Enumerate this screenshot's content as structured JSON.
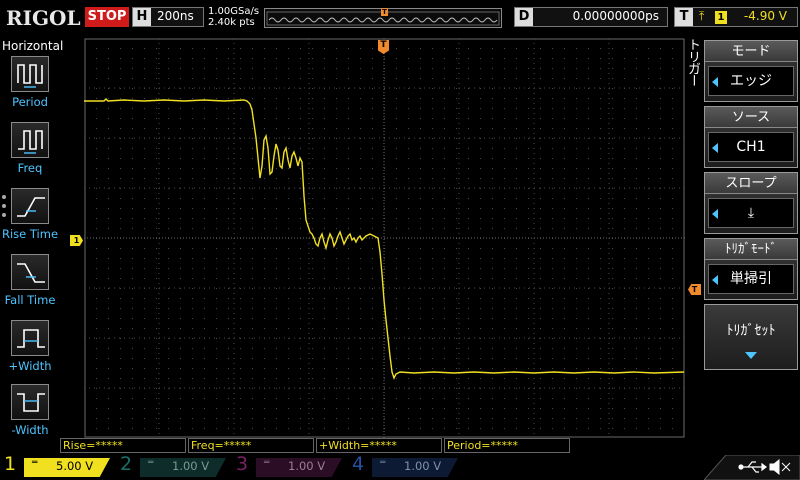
{
  "brand": {
    "logo": "RIGOL"
  },
  "status": {
    "run_state": "STOP"
  },
  "horizontal": {
    "label": "H",
    "timebase": "200ns"
  },
  "acquisition": {
    "sample_rate": "1.00GSa/s",
    "points": "2.40k pts"
  },
  "delay": {
    "label": "D",
    "value": "0.00000000ps"
  },
  "trigger_status": {
    "label": "T",
    "edge_symbol": "⤒",
    "channel": "1",
    "level": "-4.90 V"
  },
  "left_panel": {
    "title": "Horizontal",
    "items": [
      {
        "label": "Period",
        "icon": "period-icon"
      },
      {
        "label": "Freq",
        "icon": "freq-icon"
      },
      {
        "label": "Rise Time",
        "icon": "rise-time-icon"
      },
      {
        "label": "Fall Time",
        "icon": "fall-time-icon"
      },
      {
        "label": "+Width",
        "icon": "positive-width-icon"
      },
      {
        "label": "-Width",
        "icon": "negative-width-icon"
      }
    ]
  },
  "markers": {
    "channel_marker": "1",
    "trigger_marker": "T",
    "trigger_level_marker": "T"
  },
  "right_menu": {
    "title": "トリガー",
    "items": [
      {
        "header": "モード",
        "value": "エッジ"
      },
      {
        "header": "ソース",
        "value": "CH1"
      },
      {
        "header": "スロープ",
        "value": "⤓"
      },
      {
        "header": "ﾄﾘｶﾞﾓｰﾄﾞ",
        "value": "単掃引"
      }
    ],
    "bottom_button": "ﾄﾘｶﾞｾｯﾄ"
  },
  "measurements": [
    {
      "label": "Rise=*****"
    },
    {
      "label": "Freq=*****"
    },
    {
      "label": "+Width=*****"
    },
    {
      "label": "Period=*****"
    }
  ],
  "channels": [
    {
      "number": "1",
      "coupling": "═",
      "scale": "5.00 V",
      "color": "#f0e020",
      "active": true
    },
    {
      "number": "2",
      "coupling": "═",
      "scale": "1.00 V",
      "color": "#1fb9b0",
      "active": false
    },
    {
      "number": "3",
      "coupling": "═",
      "scale": "1.00 V",
      "color": "#c0309c",
      "active": false
    },
    {
      "number": "4",
      "coupling": "═",
      "scale": "1.00 V",
      "color": "#2c6cd8",
      "active": false
    }
  ],
  "status_icons": [
    "usb-icon",
    "speaker-mute-icon"
  ],
  "colors": {
    "trace": "#f0e020",
    "trigger": "#f08a2c",
    "accent": "#4ec4ff",
    "stop": "#d01b1b"
  }
}
